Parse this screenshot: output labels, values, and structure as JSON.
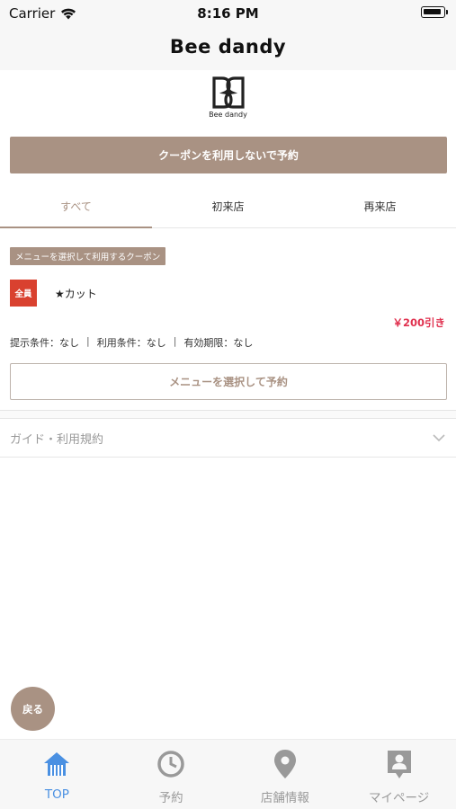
{
  "status_bar": {
    "carrier": "Carrier",
    "time": "8:16 PM"
  },
  "nav": {
    "title": "Bee dandy"
  },
  "logo": {
    "text": "Bee dandy"
  },
  "primary_button": {
    "label": "クーポンを利用しないで予約"
  },
  "tabs": [
    {
      "label": "すべて",
      "active": true
    },
    {
      "label": "初来店",
      "active": false
    },
    {
      "label": "再来店",
      "active": false
    }
  ],
  "coupon": {
    "tag": "メニューを選択して利用するクーポン",
    "badge": "全員",
    "name": "★カット",
    "discount": "￥200引き",
    "conditions": [
      "提示条件：なし",
      "利用条件：なし",
      "有効期限：なし"
    ],
    "separator": "|",
    "select_button": "メニューを選択して予約"
  },
  "guide": {
    "label": "ガイド・利用規約"
  },
  "back_button": {
    "label": "戻る"
  },
  "tab_bar": [
    {
      "label": "TOP",
      "icon": "home-icon",
      "active": true
    },
    {
      "label": "予約",
      "icon": "clock-icon",
      "active": false
    },
    {
      "label": "店舗情報",
      "icon": "location-pin-icon",
      "active": false
    },
    {
      "label": "マイページ",
      "icon": "profile-icon",
      "active": false
    }
  ],
  "colors": {
    "accent": "#a99283",
    "badge": "#d9412f",
    "discount": "#e0304e",
    "tab_active": "#4a90e2",
    "tab_inactive": "#999999"
  }
}
